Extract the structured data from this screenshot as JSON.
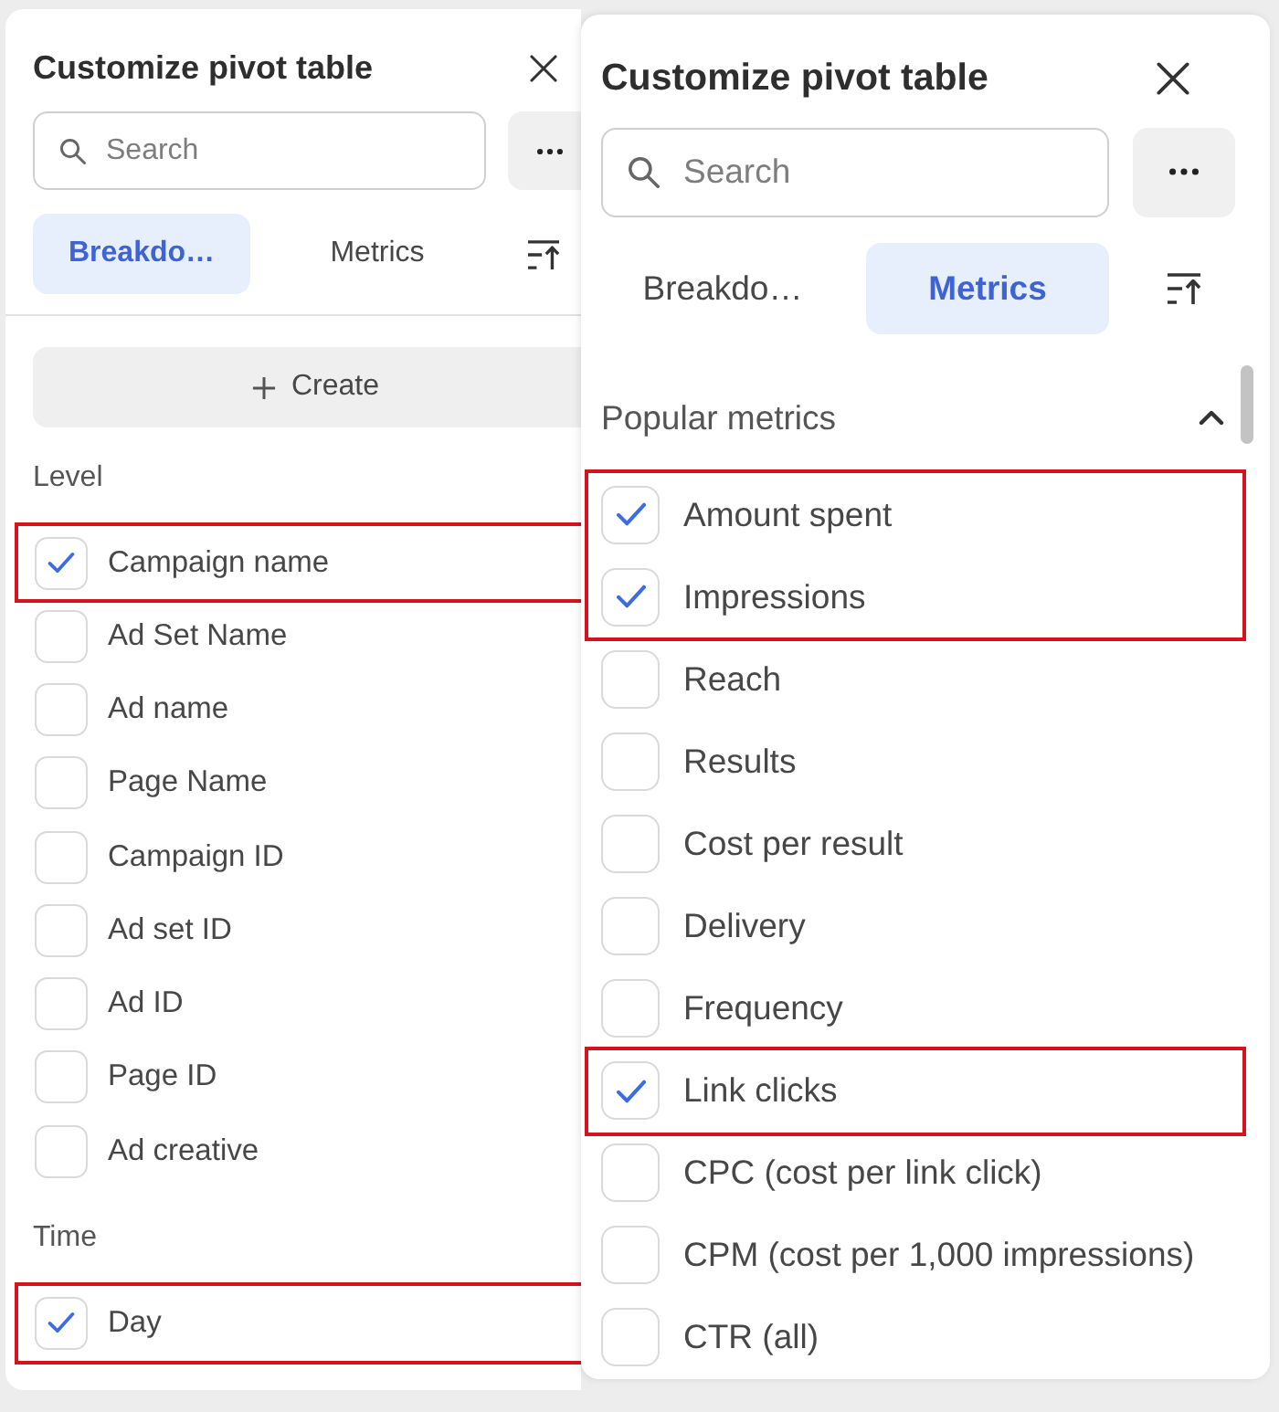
{
  "panels": [
    {
      "title": "Customize pivot table",
      "search": {
        "placeholder": "Search"
      },
      "tabs": [
        {
          "label": "Breakdo…",
          "selected": true
        },
        {
          "label": "Metrics",
          "selected": false
        }
      ],
      "create_button": {
        "label": "Create"
      },
      "sections": [
        {
          "heading": "Level",
          "items": [
            {
              "label": "Campaign name",
              "checked": true,
              "highlighted": true
            },
            {
              "label": "Ad Set Name",
              "checked": false,
              "highlighted": false
            },
            {
              "label": "Ad name",
              "checked": false,
              "highlighted": false
            },
            {
              "label": "Page Name",
              "checked": false,
              "highlighted": false
            },
            {
              "label": "Campaign ID",
              "checked": false,
              "highlighted": false
            },
            {
              "label": "Ad set ID",
              "checked": false,
              "highlighted": false
            },
            {
              "label": "Ad ID",
              "checked": false,
              "highlighted": false
            },
            {
              "label": "Page ID",
              "checked": false,
              "highlighted": false
            },
            {
              "label": "Ad creative",
              "checked": false,
              "highlighted": false
            }
          ]
        },
        {
          "heading": "Time",
          "items": [
            {
              "label": "Day",
              "checked": true,
              "highlighted": true
            }
          ]
        }
      ]
    },
    {
      "title": "Customize pivot table",
      "search": {
        "placeholder": "Search"
      },
      "tabs": [
        {
          "label": "Breakdo…",
          "selected": false
        },
        {
          "label": "Metrics",
          "selected": true
        }
      ],
      "scrollbar": true,
      "sections": [
        {
          "heading": "Popular metrics",
          "expanded": true,
          "items": [
            {
              "label": "Amount spent",
              "checked": true,
              "highlighted": true
            },
            {
              "label": "Impressions",
              "checked": true,
              "highlighted": true
            },
            {
              "label": "Reach",
              "checked": false,
              "highlighted": false
            },
            {
              "label": "Results",
              "checked": false,
              "highlighted": false
            },
            {
              "label": "Cost per result",
              "checked": false,
              "highlighted": false
            },
            {
              "label": "Delivery",
              "checked": false,
              "highlighted": false
            },
            {
              "label": "Frequency",
              "checked": false,
              "highlighted": false
            },
            {
              "label": "Link clicks",
              "checked": true,
              "highlighted": true
            },
            {
              "label": "CPC (cost per link click)",
              "checked": false,
              "highlighted": false
            },
            {
              "label": "CPM (cost per 1,000 impressions)",
              "checked": false,
              "highlighted": false
            },
            {
              "label": "CTR (all)",
              "checked": false,
              "highlighted": false
            }
          ]
        }
      ]
    }
  ]
}
